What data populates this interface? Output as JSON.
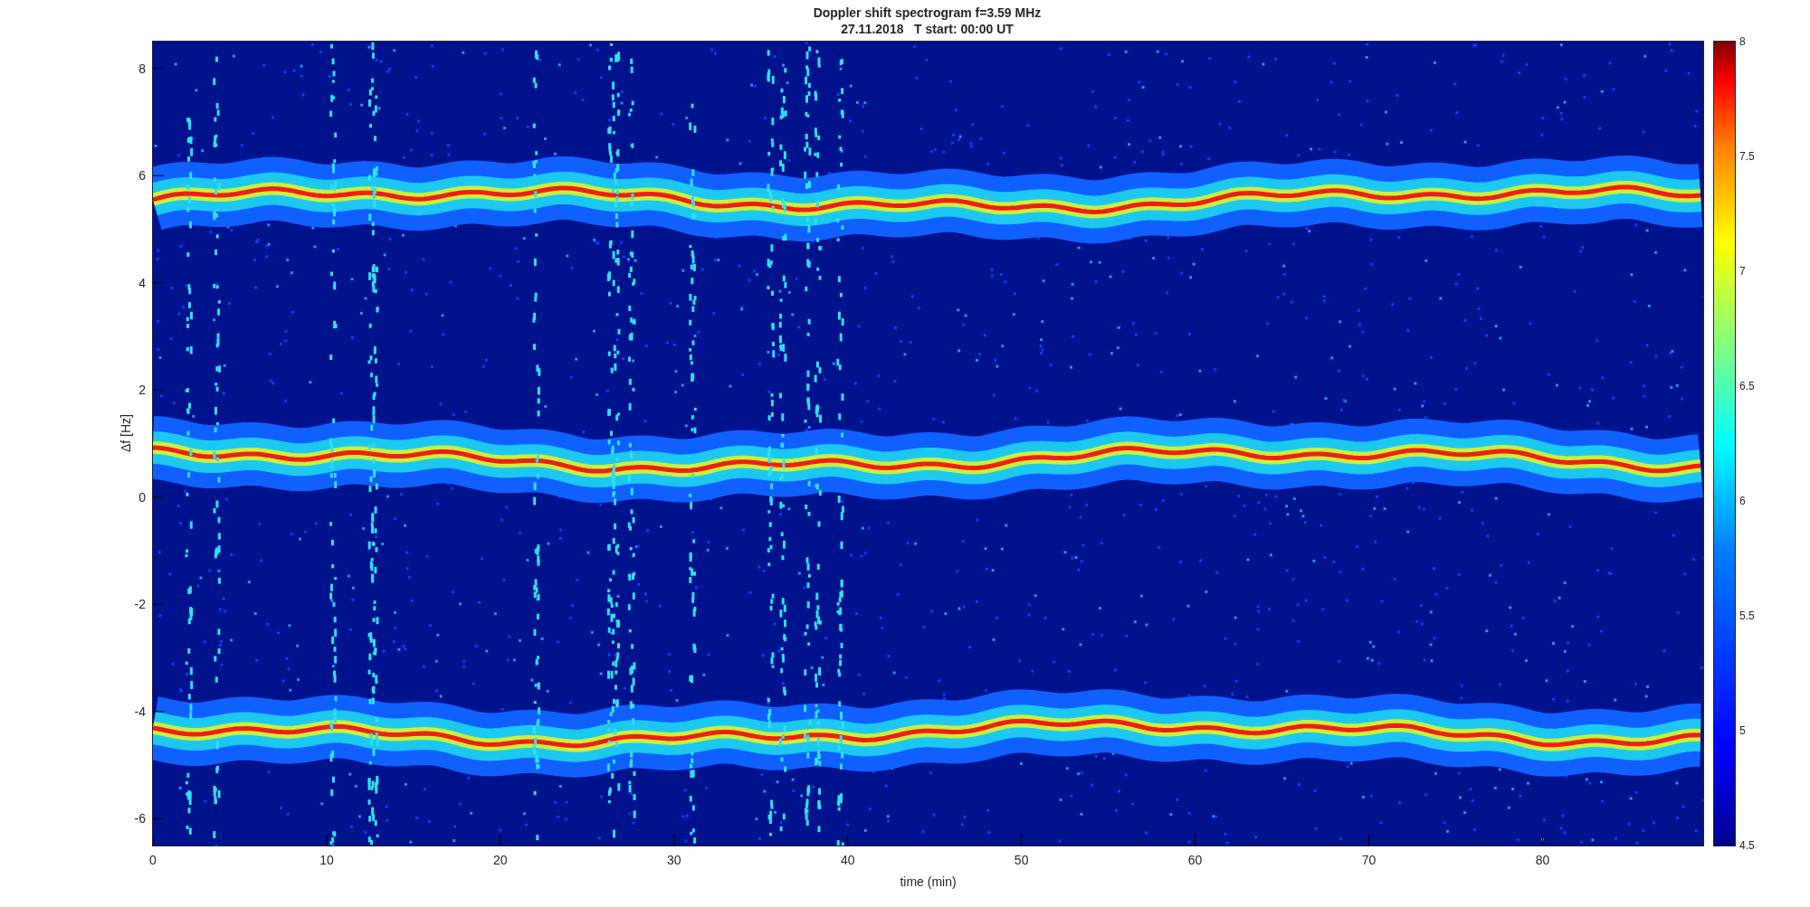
{
  "figure": {
    "title_lines": [
      "Doppler shift spectrogram f=3.59 MHz",
      "27.11.2018   T start: 00:00 UT"
    ],
    "xlabel": "time (min)",
    "ylabel": "Δf [Hz]",
    "xticks": [
      "0",
      "10",
      "20",
      "30",
      "40",
      "50",
      "60",
      "70",
      "80"
    ],
    "yticks": [
      "8",
      "6",
      "4",
      "2",
      "0",
      "-2",
      "-4",
      "-6"
    ],
    "colorbar_ticks": [
      "8",
      "7.5",
      "7",
      "6.5",
      "6",
      "5.5",
      "5",
      "4.5"
    ]
  }
}
